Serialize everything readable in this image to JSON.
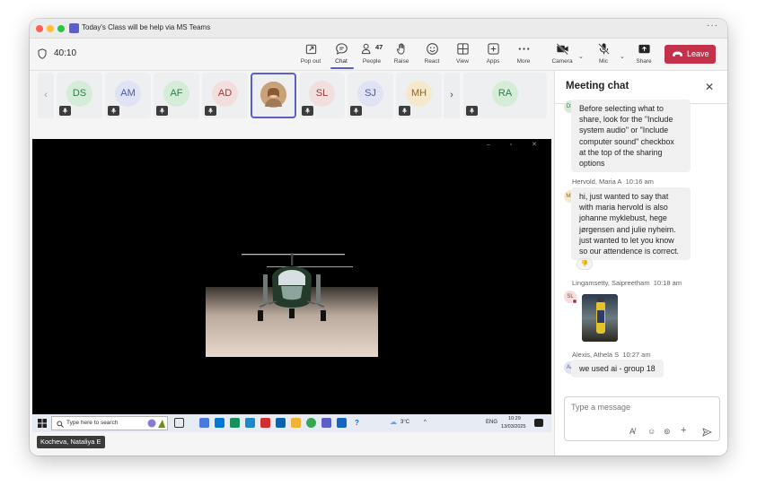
{
  "window": {
    "title": "Today's Class will be help via MS Teams",
    "more": "···"
  },
  "toolbar": {
    "timer": "40:10",
    "buttons": [
      {
        "id": "popout",
        "label": "Pop out"
      },
      {
        "id": "chat",
        "label": "Chat"
      },
      {
        "id": "people",
        "label": "People",
        "count": "47"
      },
      {
        "id": "raise",
        "label": "Raise"
      },
      {
        "id": "react",
        "label": "React"
      },
      {
        "id": "view",
        "label": "View"
      },
      {
        "id": "apps",
        "label": "Apps"
      },
      {
        "id": "more",
        "label": "More"
      },
      {
        "id": "camera",
        "label": "Camera"
      },
      {
        "id": "mic",
        "label": "Mic"
      },
      {
        "id": "share",
        "label": "Share"
      }
    ],
    "leave_label": "Leave",
    "leave_color": "#c4314b",
    "accent_color": "#5b5fc7"
  },
  "gallery": {
    "participants": [
      {
        "initials": "DS",
        "bg": "#d5ecd9",
        "fg": "#2e7d4a"
      },
      {
        "initials": "AM",
        "bg": "#dfe3f3",
        "fg": "#4a5a9a"
      },
      {
        "initials": "AF",
        "bg": "#d5ecd9",
        "fg": "#2e7d4a"
      },
      {
        "initials": "AD",
        "bg": "#f3dede",
        "fg": "#9a3a3a"
      },
      {
        "initials": "",
        "bg": "#c9a27a",
        "fg": "#ffffff",
        "photo": true
      },
      {
        "initials": "SL",
        "bg": "#f3dede",
        "fg": "#9a3a3a"
      },
      {
        "initials": "SJ",
        "bg": "#dfe3f3",
        "fg": "#4a5a9a"
      },
      {
        "initials": "MH",
        "bg": "#f6e8cc",
        "fg": "#8a6a1a"
      }
    ],
    "overflow": {
      "initials": "RA",
      "bg": "#d5ecd9",
      "fg": "#2e7d4a"
    }
  },
  "screen_share": {
    "presenter_name": "Kocheva, Nataliya E",
    "taskbar": {
      "search_placeholder": "Type here to search",
      "weather": "3°C",
      "language": "ENG",
      "time": "10:29",
      "date": "13/03/2025"
    }
  },
  "chat": {
    "title": "Meeting chat",
    "messages": [
      {
        "avatar": "DS",
        "avatar_bg": "#d5ecd9",
        "avatar_fg": "#2e7d4a",
        "sender": "",
        "time": "",
        "text_lines": [
          "Before selecting what to",
          "share, look for the \"Include",
          "system audio\" or \"Include",
          "computer sound\" checkbox",
          "at the top of the sharing",
          "options"
        ]
      },
      {
        "avatar": "MH",
        "avatar_bg": "#f6e8cc",
        "avatar_fg": "#8a6a1a",
        "sender": "Hervold, Maria A",
        "time": "10:16 am",
        "text_lines": [
          "hi, just wanted to say that",
          "with maria hervold is also",
          "johanne myklebust, hege",
          "jørgensen and julie nyheim.",
          "just wanted to let you know",
          "so our attendence is correct."
        ],
        "reaction": "👎"
      },
      {
        "avatar": "SL",
        "avatar_bg": "#f3dede",
        "avatar_fg": "#9a3a3a",
        "sender": "Lingamsetty, Saipreetham",
        "time": "10:18 am",
        "attachment": "image"
      },
      {
        "avatar": "AA",
        "avatar_bg": "#dfe3f3",
        "avatar_fg": "#4a5a9a",
        "sender": "Alexis, Athela S",
        "time": "10:27 am",
        "text_lines": [
          "we used ai - group 18"
        ]
      }
    ],
    "compose_placeholder": "Type a message"
  }
}
